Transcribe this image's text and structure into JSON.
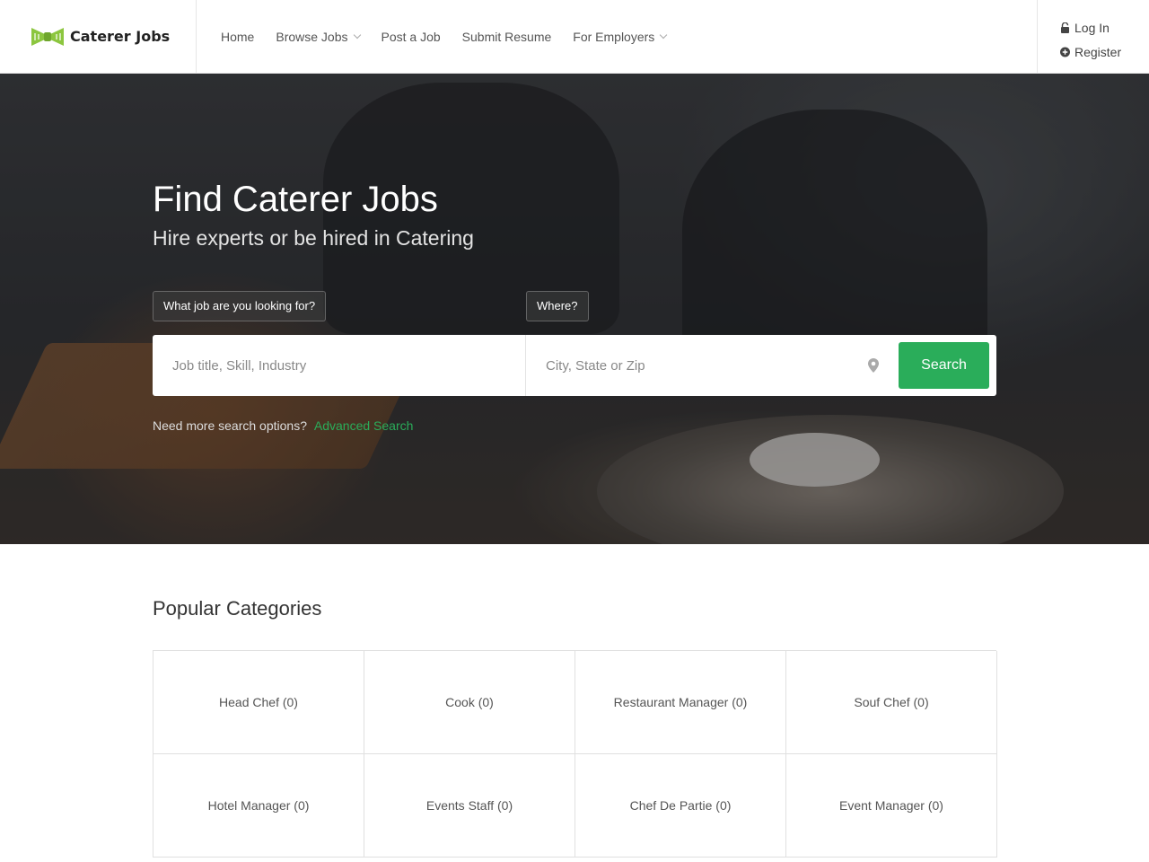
{
  "header": {
    "logo_text": "Caterer Jobs",
    "nav": [
      {
        "label": "Home",
        "has_dropdown": false
      },
      {
        "label": "Browse Jobs",
        "has_dropdown": true
      },
      {
        "label": "Post a Job",
        "has_dropdown": false
      },
      {
        "label": "Submit Resume",
        "has_dropdown": false
      },
      {
        "label": "For Employers",
        "has_dropdown": true
      }
    ],
    "login_label": "Log In",
    "register_label": "Register"
  },
  "hero": {
    "title": "Find Caterer Jobs",
    "subtitle": "Hire experts or be hired in Catering",
    "what_label": "What job are you looking for?",
    "where_label": "Where?",
    "what_placeholder": "Job title, Skill, Industry",
    "where_placeholder": "City, State or Zip",
    "search_label": "Search",
    "more_options_text": "Need more search options?",
    "advanced_search_label": "Advanced Search"
  },
  "categories": {
    "title": "Popular Categories",
    "items": [
      "Head Chef (0)",
      "Cook (0)",
      "Restaurant Manager (0)",
      "Souf Chef (0)",
      "Hotel Manager (0)",
      "Events Staff (0)",
      "Chef De Partie (0)",
      "Event Manager (0)"
    ]
  },
  "colors": {
    "accent": "#2aad5a",
    "logo_green": "#8cc63f",
    "text_dark": "#333333"
  },
  "icons": [
    "bowtie-logo-icon",
    "chevron-down-icon",
    "lock-icon",
    "plus-circle-icon",
    "map-pin-icon"
  ]
}
